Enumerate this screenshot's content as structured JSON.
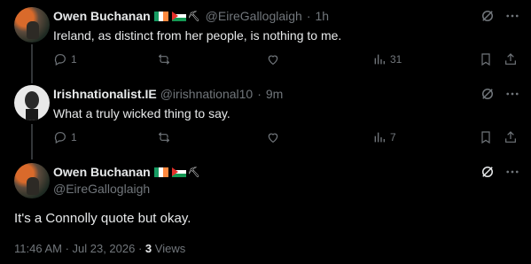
{
  "tweets": [
    {
      "name": "Owen Buchanan",
      "handle": "@EireGalloglaigh",
      "separator": "·",
      "time": "1h",
      "text": "Ireland, as distinct from her people, is nothing to me.",
      "replies": "1",
      "reposts": "",
      "likes": "",
      "views": "31"
    },
    {
      "name": "Irishnationalist.IE",
      "handle": "@irishnational10",
      "separator": "·",
      "time": "9m",
      "text": "What a truly wicked thing to say.",
      "replies": "1",
      "reposts": "",
      "likes": "",
      "views": "7"
    }
  ],
  "main_tweet": {
    "name": "Owen Buchanan",
    "handle": "@EireGalloglaigh",
    "text": "It's a Connolly quote but okay.",
    "timestamp": "11:46 AM · Jul 23, 2026 ·",
    "views_count": "3",
    "views_label": "Views"
  },
  "icons": [
    "reply-icon",
    "repost-icon",
    "like-icon",
    "views-icon",
    "bookmark-icon",
    "share-icon",
    "grok-icon",
    "more-icon"
  ],
  "colors": {
    "background": "#000000",
    "text": "#e7e9ea",
    "muted": "#71767b",
    "thread_line": "#333639"
  }
}
